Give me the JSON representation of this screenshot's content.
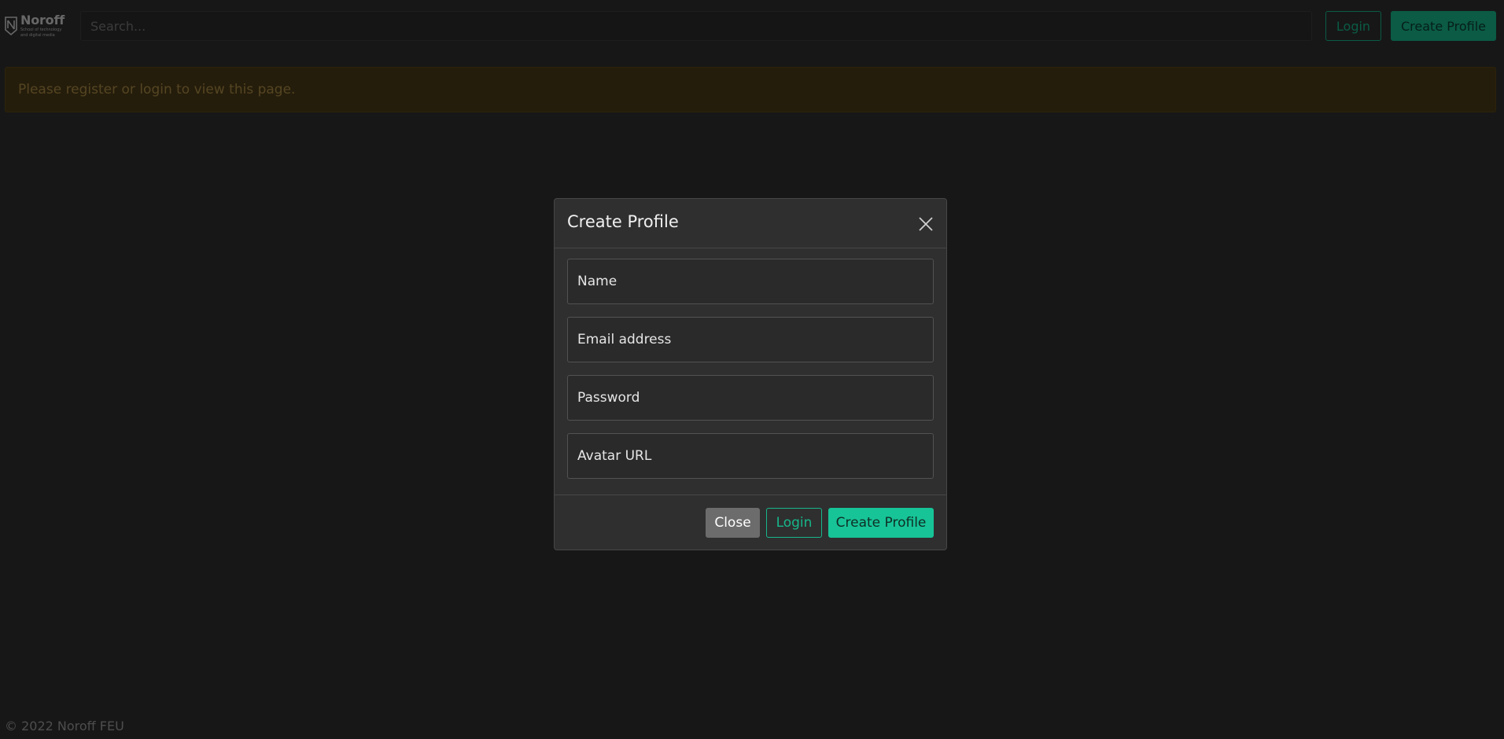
{
  "navbar": {
    "logo_name": "Noroff",
    "logo_tagline_1": "School of technology",
    "logo_tagline_2": "and digital media",
    "search_placeholder": "Search...",
    "login_label": "Login",
    "create_profile_label": "Create Profile"
  },
  "alert": {
    "message": "Please register or login to view this page."
  },
  "footer": {
    "text": "© 2022 Noroff FEU"
  },
  "modal": {
    "title": "Create Profile",
    "close_icon": "close-icon",
    "fields": {
      "name_placeholder": "Name",
      "email_placeholder": "Email address",
      "password_placeholder": "Password",
      "avatar_placeholder": "Avatar URL"
    },
    "buttons": {
      "close": "Close",
      "login": "Login",
      "create": "Create Profile"
    }
  },
  "colors": {
    "accent": "#17b78b",
    "background": "#2e2e2e",
    "alert_bg": "#4a3a17"
  }
}
